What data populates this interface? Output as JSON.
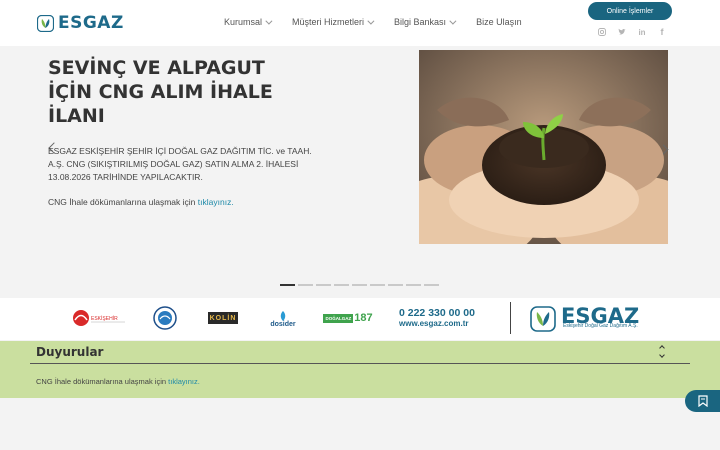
{
  "header": {
    "logo_text": "ESGAZ",
    "nav": [
      {
        "label": "Kurumsal",
        "has_dropdown": true
      },
      {
        "label": "Müşteri Hizmetleri",
        "has_dropdown": true
      },
      {
        "label": "Bilgi Bankası",
        "has_dropdown": true
      },
      {
        "label": "Bize Ulaşın",
        "has_dropdown": false
      }
    ],
    "online_button": "Online İşlemler",
    "social_icons": [
      "instagram-icon",
      "twitter-icon",
      "linkedin-icon",
      "facebook-icon"
    ]
  },
  "hero": {
    "title": "SEVİNÇ VE ALPAGUT İÇİN CNG ALIM İHALE İLANI",
    "text": "ESGAZ ESKİŞEHİR ŞEHİR İÇİ DOĞAL GAZ DAĞITIM TİC. ve TAAH. A.Ş. CNG (SIKIŞTIRILMIŞ DOĞAL GAZ) SATIN ALMA 2. İHALESİ 13.08.2026 TARİHİNDE YAPILACAKTIR.",
    "link_prefix": "CNG İhale dökümanlarına ulaşmak için",
    "link_text": "tıklayınız.",
    "slides_count": 9,
    "active_slide": 1
  },
  "partners": {
    "eskisehir_label": "ESKİŞEHİR",
    "koluk_label": "KOLİN",
    "dosider_label": "dosider",
    "dogalgaz_label": "DOĞALGAZ",
    "dogalgaz_num": "187",
    "phone": "0 222 330 00 00",
    "web": "www.esgaz.com.tr",
    "esgaz_big": "ESGAZ",
    "esgaz_sub": "Eskişehir Doğal Gaz Dağıtım A.Ş."
  },
  "announcements": {
    "title": "Duyurular",
    "text_prefix": "CNG İhale dökümanlarına ulaşmak için",
    "link_text": "tıklayınız."
  },
  "colors": {
    "brand": "#1e6a8a",
    "button": "#1a6580",
    "announce_bg": "#cadf9f",
    "link": "#1f8aa8"
  }
}
